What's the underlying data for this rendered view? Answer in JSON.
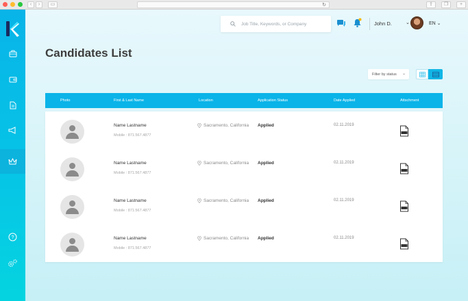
{
  "app": {
    "page_title": "Candidates List"
  },
  "header": {
    "search_placeholder": "Job Title, Keywords, or Company",
    "user_name": "John D.",
    "language": "EN"
  },
  "toolbar": {
    "filter_label": "Filter by status"
  },
  "table": {
    "columns": [
      "Photo",
      "First & Last Name",
      "Location",
      "Application Status",
      "Date Applied",
      "Attschment"
    ],
    "rows": [
      {
        "name": "Name Lastname",
        "mobile": "Mobile : 871.567.4877",
        "location": "Sacramento, California",
        "status": "Applied",
        "date": "02.11.2019"
      },
      {
        "name": "Name Lastname",
        "mobile": "Mobile : 871.567.4877",
        "location": "Sacramento, California",
        "status": "Applied",
        "date": "02.11.2019"
      },
      {
        "name": "Name Lastname",
        "mobile": "Mobile : 871.567.4877",
        "location": "Sacramento, California",
        "status": "Applied",
        "date": "02.11.2019"
      },
      {
        "name": "Name Lastname",
        "mobile": "Mobile : 871.567.4877",
        "location": "Sacramento, California",
        "status": "Applied",
        "date": "02.11.2019"
      }
    ]
  },
  "sidebar": {
    "icons": [
      "briefcase-icon",
      "wallet-icon",
      "document-icon",
      "megaphone-icon",
      "crown-icon",
      "help-icon",
      "settings-icon"
    ]
  },
  "colors": {
    "accent": "#0ab4e8",
    "sidebar_top": "#08b4e8",
    "sidebar_bottom": "#05d4e0",
    "notification": "#f5b800"
  }
}
